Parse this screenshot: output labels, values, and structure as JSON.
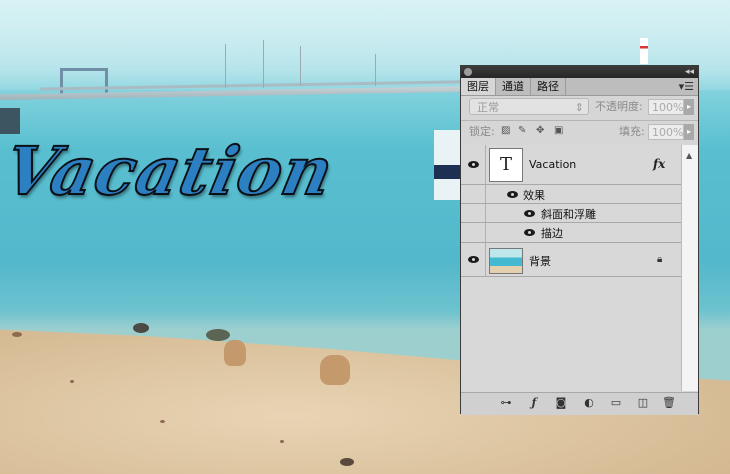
{
  "canvas": {
    "text_layer_preview": "Vacation"
  },
  "panel": {
    "tabs": [
      "图层",
      "通道",
      "路径"
    ],
    "blend_mode": "正常",
    "opacity_label": "不透明度:",
    "opacity_value": "100%",
    "lock_label": "锁定:",
    "fill_label": "填充:",
    "fill_value": "100%",
    "layers": {
      "text_layer": {
        "name": "Vacation",
        "thumb_glyph": "T",
        "fx_badge": "fx",
        "effects_label": "效果",
        "effects": [
          "斜面和浮雕",
          "描边"
        ]
      },
      "background_layer": {
        "name": "背景"
      }
    }
  },
  "icons": {
    "eye": "eye-icon",
    "link": "link-layers-icon",
    "fx": "add-style-icon",
    "mask": "add-mask-icon",
    "adjustment": "new-adjustment-icon",
    "group": "new-group-folder-icon",
    "new_layer": "new-layer-icon",
    "trash": "delete-layer-icon",
    "lock": "lock-icon"
  },
  "colors": {
    "panel_bg": "#d6d6d6",
    "titlebar": "#2b2b2b",
    "text_fill": "#2c7fc0"
  }
}
